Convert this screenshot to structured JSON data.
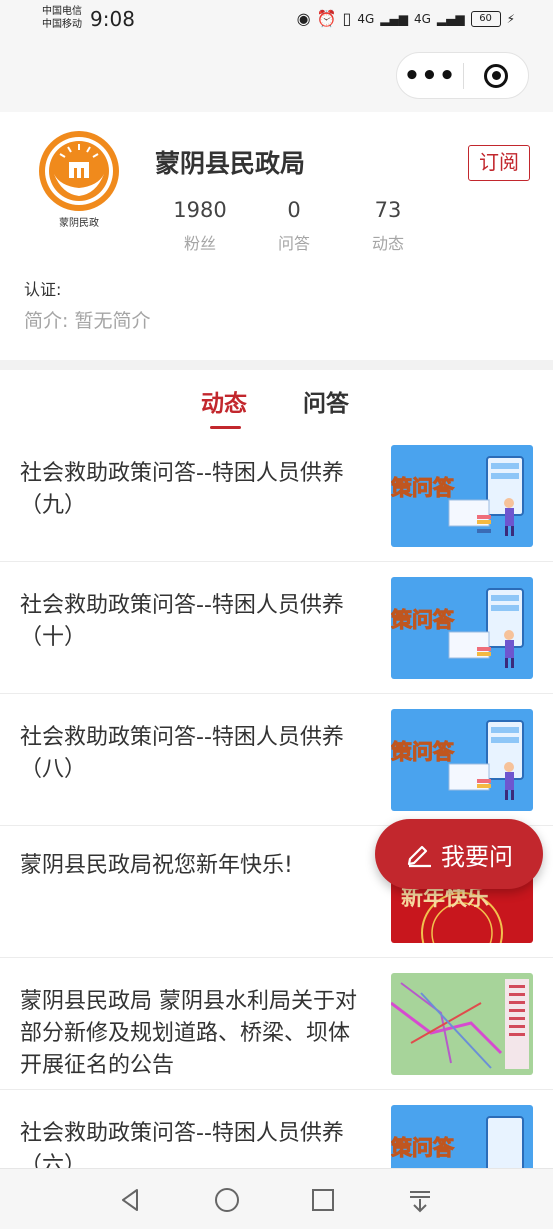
{
  "status_bar": {
    "carrier_1": "中国电信",
    "carrier_2": "中国移动",
    "time": "9:08",
    "network_1": "4G",
    "network_2": "4G",
    "battery": "60"
  },
  "navbar": {
    "more_label": "•••"
  },
  "profile": {
    "logo_caption": "蒙阴民政",
    "name": "蒙阴县民政局",
    "subscribe_label": "订阅",
    "stats": [
      {
        "value": "1980",
        "label": "粉丝"
      },
      {
        "value": "0",
        "label": "问答"
      },
      {
        "value": "73",
        "label": "动态"
      }
    ],
    "certification": "认证:",
    "intro": "简介:  暂无简介"
  },
  "tabs": {
    "active": "动态",
    "other": "问答"
  },
  "feed": [
    {
      "title": "社会救助政策问答--特困人员供养（九）",
      "thumb": "policy-qa",
      "thumb_text": "策问答"
    },
    {
      "title": "社会救助政策问答--特困人员供养（十）",
      "thumb": "policy-qa",
      "thumb_text": "策问答"
    },
    {
      "title": "社会救助政策问答--特困人员供养（八）",
      "thumb": "policy-qa",
      "thumb_text": "策问答"
    },
    {
      "title": "蒙阴县民政局祝您新年快乐!",
      "thumb": "new-year",
      "thumb_text": "新年快乐"
    },
    {
      "title": "蒙阴县民政局    蒙阴县水利局关于对部分新修及规划道路、桥梁、坝体开展征名的公告",
      "thumb": "map",
      "thumb_text": ""
    },
    {
      "title": "社会救助政策问答--特困人员供养（六）",
      "thumb": "policy-qa",
      "thumb_text": "策问答"
    }
  ],
  "ask_button": {
    "label": "我要问"
  },
  "colors": {
    "accent": "#c2272d",
    "logo_orange": "#f08a1c",
    "thumb_blue": "#4aa3ee"
  }
}
